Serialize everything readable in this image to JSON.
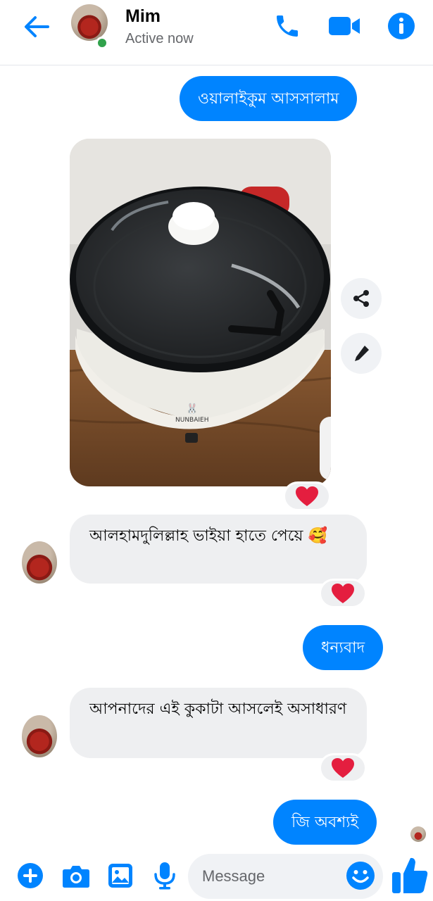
{
  "header": {
    "contact_name": "Mim",
    "status": "Active now"
  },
  "messages": [
    {
      "direction": "outgoing",
      "text": "ওয়ালাইকুম আসসালাম"
    },
    {
      "direction": "incoming",
      "type": "photo",
      "reaction": "❤️"
    },
    {
      "direction": "incoming",
      "text": "আলহামদুলিল্লাহ ভাইয়া হাতে পেয়ে 🥰",
      "reaction": "❤️"
    },
    {
      "direction": "outgoing",
      "text": "ধন্যবাদ"
    },
    {
      "direction": "incoming",
      "text": "আপনাদের এই কুকাটা আসলেই অসাধারণ",
      "reaction": "❤️"
    },
    {
      "direction": "outgoing",
      "text": "জি অবশ্যই"
    }
  ],
  "photo": {
    "brand_text": "NUNBAIEH"
  },
  "composer": {
    "placeholder": "Message"
  },
  "colors": {
    "accent": "#0084ff",
    "incoming_bubble": "#eeeff1",
    "presence": "#31a24c",
    "heart": "#e41e3f"
  },
  "icons": [
    "back-arrow-icon",
    "phone-icon",
    "video-camera-icon",
    "info-icon",
    "share-icon",
    "edit-pencil-icon",
    "plus-icon",
    "camera-icon",
    "image-icon",
    "microphone-icon",
    "emoji-icon",
    "thumbs-up-icon",
    "heart-icon"
  ]
}
